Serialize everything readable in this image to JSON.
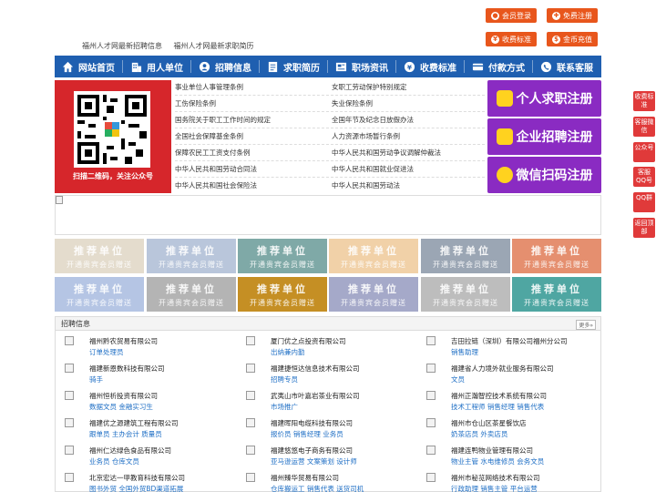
{
  "top_buttons": [
    {
      "label": "会员登录",
      "icon": "user-icon"
    },
    {
      "label": "免费注册",
      "icon": "register-icon"
    },
    {
      "label": "收费标准",
      "icon": "price-icon"
    },
    {
      "label": "金币充值",
      "icon": "coin-icon"
    }
  ],
  "head_links": [
    "福州人才网最新招聘信息",
    "福州人才网最新求职简历"
  ],
  "nav": [
    {
      "label": "网站首页",
      "icon": "home-icon"
    },
    {
      "label": "用人单位",
      "icon": "building-icon"
    },
    {
      "label": "招聘信息",
      "icon": "recruit-icon"
    },
    {
      "label": "求职简历",
      "icon": "resume-icon"
    },
    {
      "label": "职场资讯",
      "icon": "news-icon"
    },
    {
      "label": "收费标准",
      "icon": "price-icon"
    },
    {
      "label": "付款方式",
      "icon": "payment-icon"
    },
    {
      "label": "联系客服",
      "icon": "phone-icon"
    }
  ],
  "qr": {
    "caption": "扫描二维码，关注公众号"
  },
  "laws_left": [
    "事业单位人事管理条例",
    "工伤保险条例",
    "国务院关于职工工作时间的规定",
    "全国社会保障基金条例",
    "保障农民工工资支付条例",
    "中华人民共和国劳动合同法",
    "中华人民共和国社会保险法"
  ],
  "laws_right": [
    "女职工劳动保护特别规定",
    "失业保险条例",
    "全国年节及纪念日放假办法",
    "人力资源市场暂行条例",
    "中华人民共和国劳动争议调解仲裁法",
    "中华人民共和国就业促进法",
    "中华人民共和国劳动法"
  ],
  "register": [
    {
      "label": "个人求职注册",
      "icon": "person-icon"
    },
    {
      "label": "企业招聘注册",
      "icon": "company-icon"
    },
    {
      "label": "微信扫码注册",
      "icon": "wechat-icon"
    }
  ],
  "tiles": {
    "line1": "推荐单位",
    "line2": "开通贵宾会员赠送",
    "colors": [
      "#e4dccd",
      "#b9c6db",
      "#7fa9a7",
      "#f1d1a8",
      "#9ba6b4",
      "#e58f6f",
      "#b5c5e4",
      "#b4b4b4",
      "#c58f24",
      "#a5a9c9",
      "#bdbdbd",
      "#4fa6a2"
    ]
  },
  "jobs": {
    "title": "招聘信息",
    "more": "更多»",
    "rows": [
      [
        {
          "name": "福州黔农贸易有限公司",
          "jobs": "订单处理员"
        },
        {
          "name": "厦门优之点投资有限公司",
          "jobs": "出纳兼内勤"
        },
        {
          "name": "吉田拉链（深圳）有限公司福州分公司",
          "jobs": "销售助理"
        }
      ],
      [
        {
          "name": "福建新恩数科技有限公司",
          "jobs": "骑手"
        },
        {
          "name": "福建捷恒达信息技术有限公司",
          "jobs": "招聘专员"
        },
        {
          "name": "福建省人力境外就业服务有限公司",
          "jobs": "文员"
        }
      ],
      [
        {
          "name": "福州恒析投资有限公司",
          "jobs": "数据文员 金融实习生"
        },
        {
          "name": "武夷山市叶嘉岩茶业有限公司",
          "jobs": "市场推广"
        },
        {
          "name": "福州正瀚智控技术系统有限公司",
          "jobs": "技术工程师 销售经理 销售代表"
        }
      ],
      [
        {
          "name": "福建优之源建筑工程有限公司",
          "jobs": "跟单员 主办会计 质量员"
        },
        {
          "name": "福建晖阳电缆科技有限公司",
          "jobs": "报价员 销售经理 业务员"
        },
        {
          "name": "福州市仓山区茶星餐饮店",
          "jobs": "奶茶店员 外卖店员"
        }
      ],
      [
        {
          "name": "福州仁达绿色食品有限公司",
          "jobs": "业务员 仓库文员"
        },
        {
          "name": "福建悠悠电子商务有限公司",
          "jobs": "亚马逊运营 文案策划 设计师"
        },
        {
          "name": "福建连鸭物业管理有限公司",
          "jobs": "物业主管 水电维修员 会务文员"
        }
      ],
      [
        {
          "name": "北京宏达一甲教育科技有限公司",
          "jobs": "图书外贸 全国外贸BD渠道拓展"
        },
        {
          "name": "福州臻华贸易有限公司",
          "jobs": "仓库搬运工 销售代表 送货司机"
        },
        {
          "name": "福州市秘览网络技术有限公司",
          "jobs": "行政助理 销售主管 平台运营"
        }
      ]
    ]
  },
  "side": [
    {
      "label": "收费标准"
    },
    {
      "label": "客服微信"
    },
    {
      "label": "公众号"
    },
    {
      "label": "客服QQ号"
    },
    {
      "label": "QQ群"
    },
    {
      "label": "返回顶部"
    }
  ]
}
